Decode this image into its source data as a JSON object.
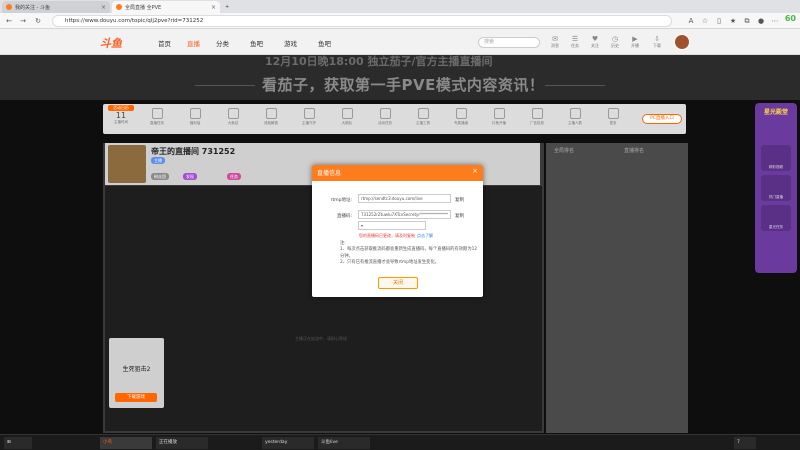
{
  "browser": {
    "tabs": [
      {
        "label": "我的关注 - 斗鱼"
      },
      {
        "label": "全局直播 全PVE"
      }
    ],
    "url": "https://www.douyu.com/topic/qlj2pve?rid=731252",
    "score": "60"
  },
  "header": {
    "logo": "斗鱼",
    "nav": [
      "首页",
      "直播",
      "分类",
      "鱼吧",
      "游戏",
      "鱼吧"
    ],
    "search_placeholder": "搜索",
    "icons": [
      "消息",
      "任务",
      "关注",
      "历史",
      "开播",
      "下载"
    ]
  },
  "banner": {
    "top_text": "12月10日晚18:00  独立茄子/官方主播直播间",
    "main_text": "看茄子，获取第一手PVE模式内容资讯！"
  },
  "activity": {
    "date_label": "活动日历",
    "date_num": "11",
    "date_sub": "主播时间",
    "items": [
      "直播任务",
      "福利抽",
      "大鱼站",
      "成就解锁",
      "主播守护",
      "大鹅队",
      "活动任务",
      "主播工具",
      "专属通道",
      "抖鱼开播",
      "广告投放",
      "主播人数",
      "更多"
    ],
    "pc_button": "PC直播入口"
  },
  "room": {
    "title": "帝王的直播间 731252",
    "tags": [
      "主播",
      "粉丝团",
      "发现",
      "任务"
    ]
  },
  "player": {
    "tip": "主播正在加油中，请耐心等候"
  },
  "ad": {
    "title": "生死狙击2",
    "button": "下载游戏"
  },
  "chat": {
    "tabs": [
      "全局排名",
      "直播排名"
    ]
  },
  "modal": {
    "title": "直播信息",
    "rtmp_label": "rtmp地址:",
    "rtmp_value": "rtmp://sendtc3.douyu.com/live",
    "key_label": "直播码:",
    "key_value": "731252rZtuwlu7XTcvSecretyr**************",
    "copy": "复制",
    "warn": "您的直播码已更改，请及时复制",
    "warn_link": "点击了解",
    "notes_title": "注:",
    "notes": [
      "1、每次点击获取推流码都会重新生成直播码，每个直播码的有效期为12分钟。",
      "2、只有已有推流直播才会导致rtmp地址发生变化。"
    ],
    "close_button": "关闭"
  },
  "side": {
    "title": "星光殿堂",
    "items": [
      "精彩视频",
      "热门直播",
      "星光任务"
    ]
  },
  "taskbar": {
    "items": [
      "小鸟",
      "正在播放",
      "yesterday",
      "斗鱼live"
    ],
    "count": "7"
  }
}
